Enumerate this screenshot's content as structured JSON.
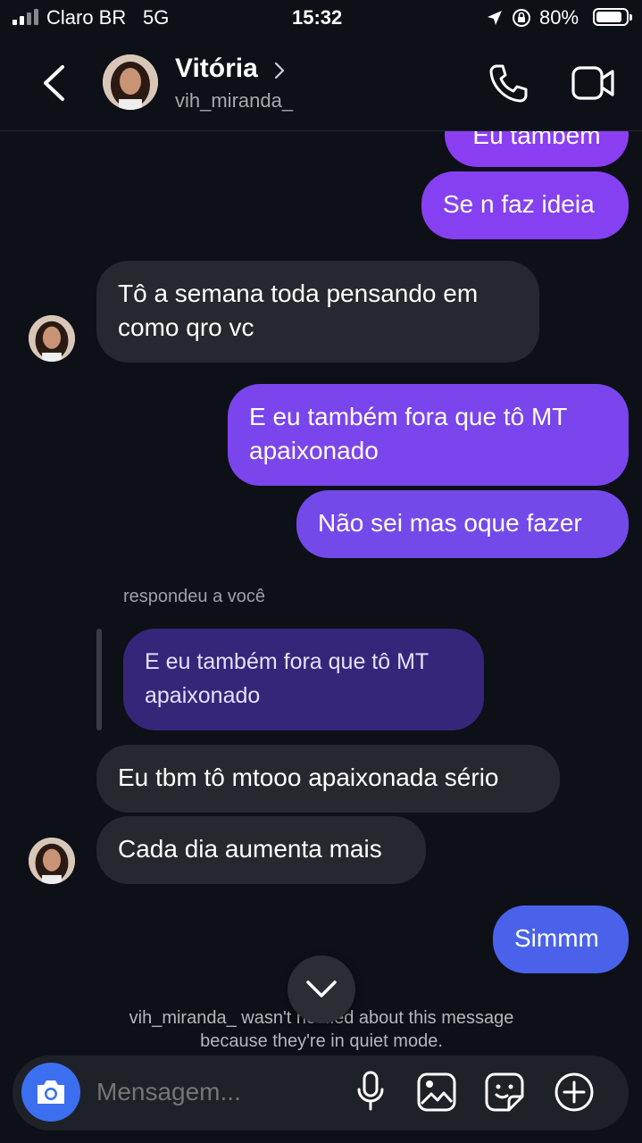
{
  "status_bar": {
    "carrier": "Claro BR",
    "network": "5G",
    "time": "15:32",
    "battery": "80%",
    "icons": [
      "signal-icon",
      "location-arrow-icon",
      "orientation-lock-icon",
      "battery-icon"
    ]
  },
  "header": {
    "name": "Vitória",
    "username": "vih_miranda_",
    "icons": [
      "back-icon",
      "chevron-right-icon",
      "phone-icon",
      "video-icon"
    ]
  },
  "messages": [
    {
      "text": "Eu também",
      "sender": "me"
    },
    {
      "text": "Se n faz ideia",
      "sender": "me"
    },
    {
      "text": "Tô a semana toda pensando em como qro vc",
      "sender": "them"
    },
    {
      "text": "E eu também fora que tô MT apaixonado",
      "sender": "me"
    },
    {
      "text": "Não sei mas oque fazer",
      "sender": "me"
    },
    {
      "text": "Eu tbm tô mtooo apaixonada sério",
      "sender": "them"
    },
    {
      "text": "Cada dia aumenta mais",
      "sender": "them"
    },
    {
      "text": "Simmm",
      "sender": "me"
    }
  ],
  "reply": {
    "label": "respondeu a você",
    "quoted_text": "E eu também fora que tô MT apaixonado"
  },
  "notice": {
    "line1": "vih_miranda_ wasn't notified about this message",
    "line2": "because they're in quiet mode."
  },
  "composer": {
    "placeholder": "Mensagem...",
    "icons": [
      "camera-icon",
      "microphone-icon",
      "gallery-icon",
      "sticker-icon",
      "plus-icon"
    ]
  },
  "colors": {
    "background": "#0d1017",
    "incoming_bubble": "#262830",
    "outgoing_purple": "#8a3ff3",
    "outgoing_blue": "#4a62ea",
    "camera_button": "#3b6ff0"
  }
}
